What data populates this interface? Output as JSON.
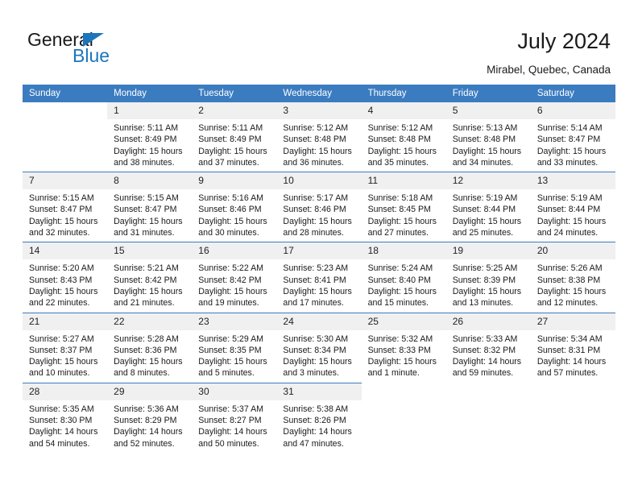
{
  "brand": {
    "name_dark": "General",
    "name_blue": "Blue",
    "accent_color": "#1c76bc"
  },
  "header": {
    "title": "July 2024",
    "location": "Mirabel, Quebec, Canada"
  },
  "calendar": {
    "header_bg": "#3b7cc0",
    "daynum_bg": "#f0f0f0",
    "weekday_labels": [
      "Sunday",
      "Monday",
      "Tuesday",
      "Wednesday",
      "Thursday",
      "Friday",
      "Saturday"
    ],
    "weeks": [
      [
        {
          "day": "",
          "lines": []
        },
        {
          "day": "1",
          "lines": [
            "Sunrise: 5:11 AM",
            "Sunset: 8:49 PM",
            "Daylight: 15 hours",
            "and 38 minutes."
          ]
        },
        {
          "day": "2",
          "lines": [
            "Sunrise: 5:11 AM",
            "Sunset: 8:49 PM",
            "Daylight: 15 hours",
            "and 37 minutes."
          ]
        },
        {
          "day": "3",
          "lines": [
            "Sunrise: 5:12 AM",
            "Sunset: 8:48 PM",
            "Daylight: 15 hours",
            "and 36 minutes."
          ]
        },
        {
          "day": "4",
          "lines": [
            "Sunrise: 5:12 AM",
            "Sunset: 8:48 PM",
            "Daylight: 15 hours",
            "and 35 minutes."
          ]
        },
        {
          "day": "5",
          "lines": [
            "Sunrise: 5:13 AM",
            "Sunset: 8:48 PM",
            "Daylight: 15 hours",
            "and 34 minutes."
          ]
        },
        {
          "day": "6",
          "lines": [
            "Sunrise: 5:14 AM",
            "Sunset: 8:47 PM",
            "Daylight: 15 hours",
            "and 33 minutes."
          ]
        }
      ],
      [
        {
          "day": "7",
          "lines": [
            "Sunrise: 5:15 AM",
            "Sunset: 8:47 PM",
            "Daylight: 15 hours",
            "and 32 minutes."
          ]
        },
        {
          "day": "8",
          "lines": [
            "Sunrise: 5:15 AM",
            "Sunset: 8:47 PM",
            "Daylight: 15 hours",
            "and 31 minutes."
          ]
        },
        {
          "day": "9",
          "lines": [
            "Sunrise: 5:16 AM",
            "Sunset: 8:46 PM",
            "Daylight: 15 hours",
            "and 30 minutes."
          ]
        },
        {
          "day": "10",
          "lines": [
            "Sunrise: 5:17 AM",
            "Sunset: 8:46 PM",
            "Daylight: 15 hours",
            "and 28 minutes."
          ]
        },
        {
          "day": "11",
          "lines": [
            "Sunrise: 5:18 AM",
            "Sunset: 8:45 PM",
            "Daylight: 15 hours",
            "and 27 minutes."
          ]
        },
        {
          "day": "12",
          "lines": [
            "Sunrise: 5:19 AM",
            "Sunset: 8:44 PM",
            "Daylight: 15 hours",
            "and 25 minutes."
          ]
        },
        {
          "day": "13",
          "lines": [
            "Sunrise: 5:19 AM",
            "Sunset: 8:44 PM",
            "Daylight: 15 hours",
            "and 24 minutes."
          ]
        }
      ],
      [
        {
          "day": "14",
          "lines": [
            "Sunrise: 5:20 AM",
            "Sunset: 8:43 PM",
            "Daylight: 15 hours",
            "and 22 minutes."
          ]
        },
        {
          "day": "15",
          "lines": [
            "Sunrise: 5:21 AM",
            "Sunset: 8:42 PM",
            "Daylight: 15 hours",
            "and 21 minutes."
          ]
        },
        {
          "day": "16",
          "lines": [
            "Sunrise: 5:22 AM",
            "Sunset: 8:42 PM",
            "Daylight: 15 hours",
            "and 19 minutes."
          ]
        },
        {
          "day": "17",
          "lines": [
            "Sunrise: 5:23 AM",
            "Sunset: 8:41 PM",
            "Daylight: 15 hours",
            "and 17 minutes."
          ]
        },
        {
          "day": "18",
          "lines": [
            "Sunrise: 5:24 AM",
            "Sunset: 8:40 PM",
            "Daylight: 15 hours",
            "and 15 minutes."
          ]
        },
        {
          "day": "19",
          "lines": [
            "Sunrise: 5:25 AM",
            "Sunset: 8:39 PM",
            "Daylight: 15 hours",
            "and 13 minutes."
          ]
        },
        {
          "day": "20",
          "lines": [
            "Sunrise: 5:26 AM",
            "Sunset: 8:38 PM",
            "Daylight: 15 hours",
            "and 12 minutes."
          ]
        }
      ],
      [
        {
          "day": "21",
          "lines": [
            "Sunrise: 5:27 AM",
            "Sunset: 8:37 PM",
            "Daylight: 15 hours",
            "and 10 minutes."
          ]
        },
        {
          "day": "22",
          "lines": [
            "Sunrise: 5:28 AM",
            "Sunset: 8:36 PM",
            "Daylight: 15 hours",
            "and 8 minutes."
          ]
        },
        {
          "day": "23",
          "lines": [
            "Sunrise: 5:29 AM",
            "Sunset: 8:35 PM",
            "Daylight: 15 hours",
            "and 5 minutes."
          ]
        },
        {
          "day": "24",
          "lines": [
            "Sunrise: 5:30 AM",
            "Sunset: 8:34 PM",
            "Daylight: 15 hours",
            "and 3 minutes."
          ]
        },
        {
          "day": "25",
          "lines": [
            "Sunrise: 5:32 AM",
            "Sunset: 8:33 PM",
            "Daylight: 15 hours",
            "and 1 minute."
          ]
        },
        {
          "day": "26",
          "lines": [
            "Sunrise: 5:33 AM",
            "Sunset: 8:32 PM",
            "Daylight: 14 hours",
            "and 59 minutes."
          ]
        },
        {
          "day": "27",
          "lines": [
            "Sunrise: 5:34 AM",
            "Sunset: 8:31 PM",
            "Daylight: 14 hours",
            "and 57 minutes."
          ]
        }
      ],
      [
        {
          "day": "28",
          "lines": [
            "Sunrise: 5:35 AM",
            "Sunset: 8:30 PM",
            "Daylight: 14 hours",
            "and 54 minutes."
          ]
        },
        {
          "day": "29",
          "lines": [
            "Sunrise: 5:36 AM",
            "Sunset: 8:29 PM",
            "Daylight: 14 hours",
            "and 52 minutes."
          ]
        },
        {
          "day": "30",
          "lines": [
            "Sunrise: 5:37 AM",
            "Sunset: 8:27 PM",
            "Daylight: 14 hours",
            "and 50 minutes."
          ]
        },
        {
          "day": "31",
          "lines": [
            "Sunrise: 5:38 AM",
            "Sunset: 8:26 PM",
            "Daylight: 14 hours",
            "and 47 minutes."
          ]
        },
        {
          "day": "",
          "lines": []
        },
        {
          "day": "",
          "lines": []
        },
        {
          "day": "",
          "lines": []
        }
      ]
    ]
  }
}
